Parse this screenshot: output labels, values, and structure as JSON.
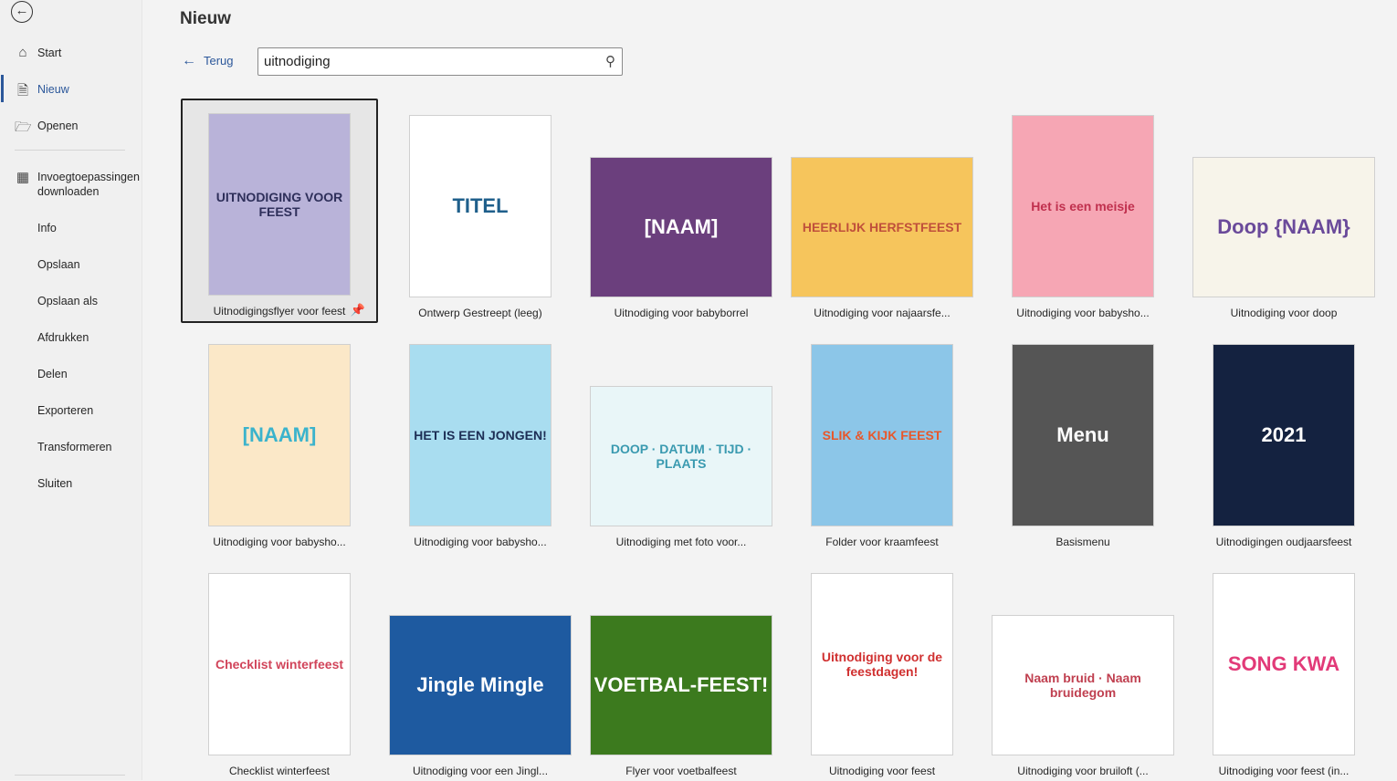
{
  "sidebar": {
    "items": [
      {
        "label": "Start",
        "icon": "home-icon"
      },
      {
        "label": "Nieuw",
        "icon": "document-icon",
        "active": true
      },
      {
        "label": "Openen",
        "icon": "folder-icon"
      },
      {
        "label": "Invoegtoepassingen downloaden",
        "icon": "addins-icon"
      },
      {
        "label": "Info"
      },
      {
        "label": "Opslaan"
      },
      {
        "label": "Opslaan als"
      },
      {
        "label": "Afdrukken"
      },
      {
        "label": "Delen"
      },
      {
        "label": "Exporteren"
      },
      {
        "label": "Transformeren"
      },
      {
        "label": "Sluiten"
      }
    ]
  },
  "header": {
    "title": "Nieuw",
    "back_label": "Terug"
  },
  "search": {
    "value": "uitnodiging"
  },
  "accent": "#2b579a",
  "templates": [
    {
      "label": "Uitnodigingsflyer voor feest",
      "thumb": "UITNODIGING VOOR FEEST",
      "bg": "#b9b3d9",
      "fg": "#2e2f5a",
      "o": "p"
    },
    {
      "label": "Ontwerp Gestreept (leeg)",
      "thumb": "TITEL",
      "bg": "#ffffff",
      "fg": "#1f5f8b",
      "o": "p"
    },
    {
      "label": "Uitnodiging voor babyborrel",
      "thumb": "[NAAM]",
      "bg": "#6b3f7d",
      "fg": "#ffffff",
      "o": "l"
    },
    {
      "label": "Uitnodiging voor najaarsfe...",
      "thumb": "HEERLIJK HERFSTFEEST",
      "bg": "#f6c55c",
      "fg": "#c0503b",
      "o": "l"
    },
    {
      "label": "Uitnodiging voor babysho...",
      "thumb": "Het is een meisje",
      "bg": "#f6a6b4",
      "fg": "#c0304e",
      "o": "p"
    },
    {
      "label": "Uitnodiging voor doop",
      "thumb": "Doop {NAAM}",
      "bg": "#f7f4ea",
      "fg": "#6a4a9a",
      "o": "l"
    },
    {
      "label": "Uitnodiging voor babysho...",
      "thumb": "[NAAM]",
      "bg": "#fbe8c8",
      "fg": "#3bb3cc",
      "o": "p"
    },
    {
      "label": "Uitnodiging voor babysho...",
      "thumb": "HET IS EEN JONGEN!",
      "bg": "#a9ddf0",
      "fg": "#1d2e55",
      "o": "p"
    },
    {
      "label": "Uitnodiging met foto voor...",
      "thumb": "DOOP · DATUM · TIJD · PLAATS",
      "bg": "#e9f6f8",
      "fg": "#3a9ab0",
      "o": "l"
    },
    {
      "label": "Folder voor kraamfeest",
      "thumb": "SLIK & KIJK FEEST",
      "bg": "#8cc6e8",
      "fg": "#e8572a",
      "o": "p"
    },
    {
      "label": "Basismenu",
      "thumb": "Menu",
      "bg": "#555555",
      "fg": "#ffffff",
      "o": "p"
    },
    {
      "label": "Uitnodigingen oudjaarsfeest",
      "thumb": "2021",
      "bg": "#142240",
      "fg": "#ffffff",
      "o": "p"
    },
    {
      "label": "Checklist winterfeest",
      "thumb": "Checklist winterfeest",
      "bg": "#ffffff",
      "fg": "#d1445a",
      "o": "p"
    },
    {
      "label": "Uitnodiging voor een Jingl...",
      "thumb": "Jingle Mingle",
      "bg": "#1e5aa0",
      "fg": "#ffffff",
      "o": "l"
    },
    {
      "label": "Flyer voor voetbalfeest",
      "thumb": "VOETBAL-FEEST!",
      "bg": "#3c7a1e",
      "fg": "#ffffff",
      "o": "l"
    },
    {
      "label": "Uitnodiging voor feest",
      "thumb": "Uitnodiging voor de feestdagen!",
      "bg": "#ffffff",
      "fg": "#d03030",
      "o": "p"
    },
    {
      "label": "Uitnodiging voor bruiloft (...",
      "thumb": "Naam bruid · Naam bruidegom",
      "bg": "#ffffff",
      "fg": "#c04050",
      "o": "l"
    },
    {
      "label": "Uitnodiging voor feest (in...",
      "thumb": "SONG KWA",
      "bg": "#ffffff",
      "fg": "#e23a78",
      "o": "p"
    }
  ]
}
